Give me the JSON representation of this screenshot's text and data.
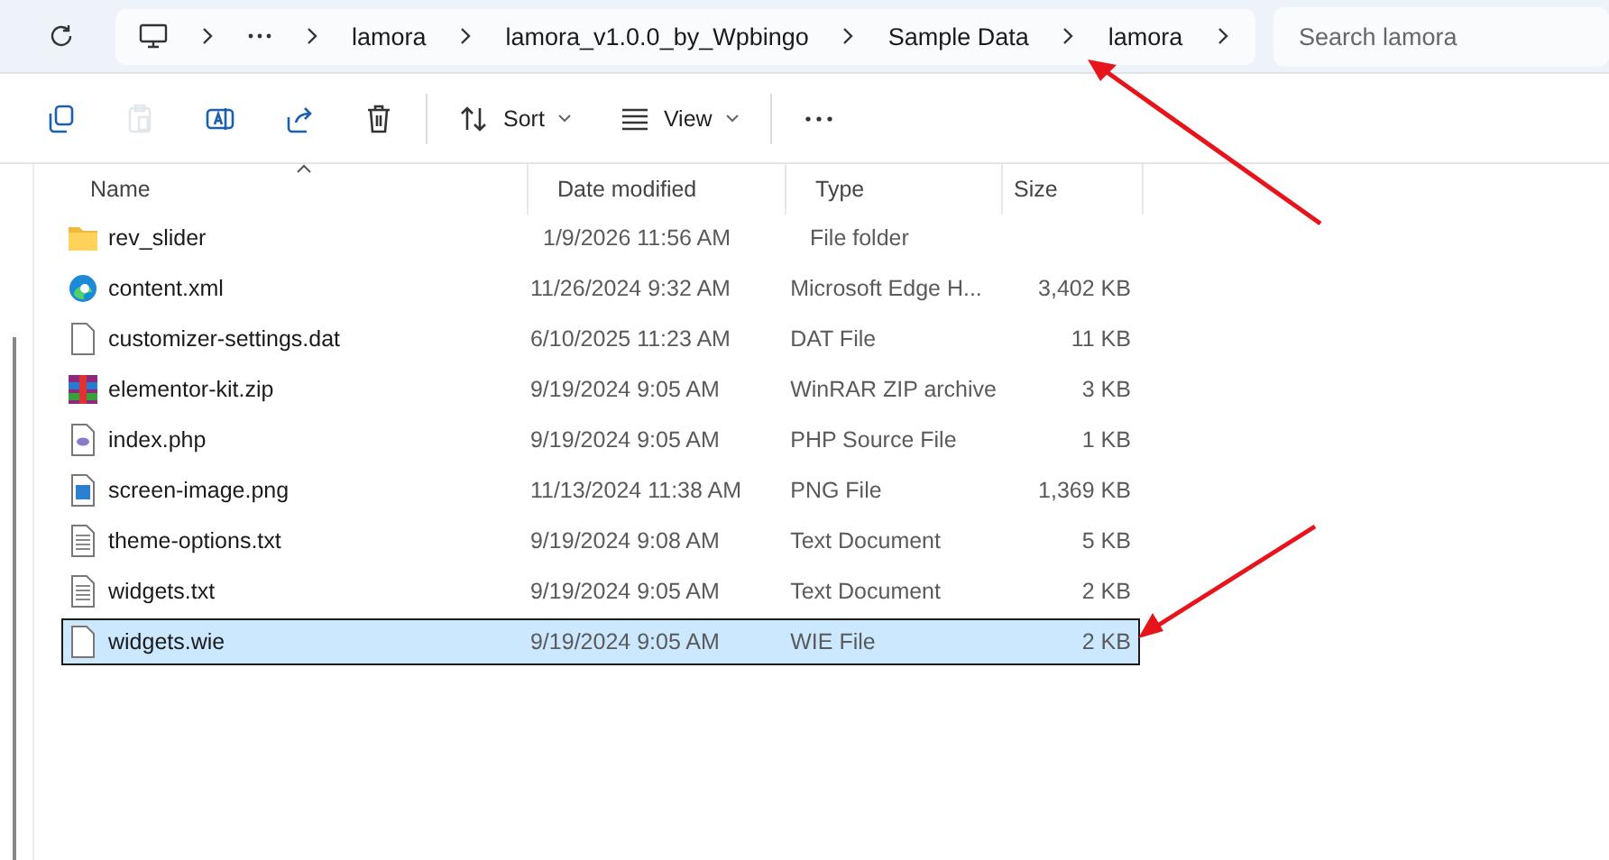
{
  "breadcrumb": [
    "lamora",
    "lamora_v1.0.0_by_Wpbingo",
    "Sample Data",
    "lamora"
  ],
  "search": {
    "placeholder": "Search lamora"
  },
  "toolbar": [
    {
      "kind": "copy",
      "disabled": false
    },
    {
      "kind": "paste",
      "disabled": true
    },
    {
      "kind": "rename",
      "disabled": false
    },
    {
      "kind": "share",
      "disabled": false
    },
    {
      "kind": "delete",
      "disabled": false
    },
    {
      "kind": "sort",
      "label": "Sort",
      "disabled": false
    },
    {
      "kind": "view",
      "label": "View",
      "disabled": false
    },
    {
      "kind": "more",
      "disabled": false
    }
  ],
  "table": {
    "columns": [
      "Name",
      "Date modified",
      "Type",
      "Size"
    ],
    "rows": [
      {
        "kind": "folder",
        "name": "rev_slider",
        "date": "1/9/2026 11:56 AM",
        "type": "File folder",
        "size": "",
        "selected": false
      },
      {
        "kind": "edge",
        "name": "content.xml",
        "date": "11/26/2024 9:32 AM",
        "type": "Microsoft Edge H...",
        "size": "3,402 KB",
        "selected": false
      },
      {
        "kind": "file",
        "name": "customizer-settings.dat",
        "date": "6/10/2025 11:23 AM",
        "type": "DAT File",
        "size": "11 KB",
        "selected": false
      },
      {
        "kind": "archive",
        "name": "elementor-kit.zip",
        "date": "9/19/2024 9:05 AM",
        "type": "WinRAR ZIP archive",
        "size": "3 KB",
        "selected": false
      },
      {
        "kind": "php",
        "name": "index.php",
        "date": "9/19/2024 9:05 AM",
        "type": "PHP Source File",
        "size": "1 KB",
        "selected": false
      },
      {
        "kind": "image",
        "name": "screen-image.png",
        "date": "11/13/2024 11:38 AM",
        "type": "PNG File",
        "size": "1,369 KB",
        "selected": false
      },
      {
        "kind": "text",
        "name": "theme-options.txt",
        "date": "9/19/2024 9:08 AM",
        "type": "Text Document",
        "size": "5 KB",
        "selected": false
      },
      {
        "kind": "text",
        "name": "widgets.txt",
        "date": "9/19/2024 9:05 AM",
        "type": "Text Document",
        "size": "2 KB",
        "selected": false
      },
      {
        "kind": "file",
        "name": "widgets.wie",
        "date": "9/19/2024 9:05 AM",
        "type": "WIE File",
        "size": "2 KB",
        "selected": true
      }
    ]
  }
}
